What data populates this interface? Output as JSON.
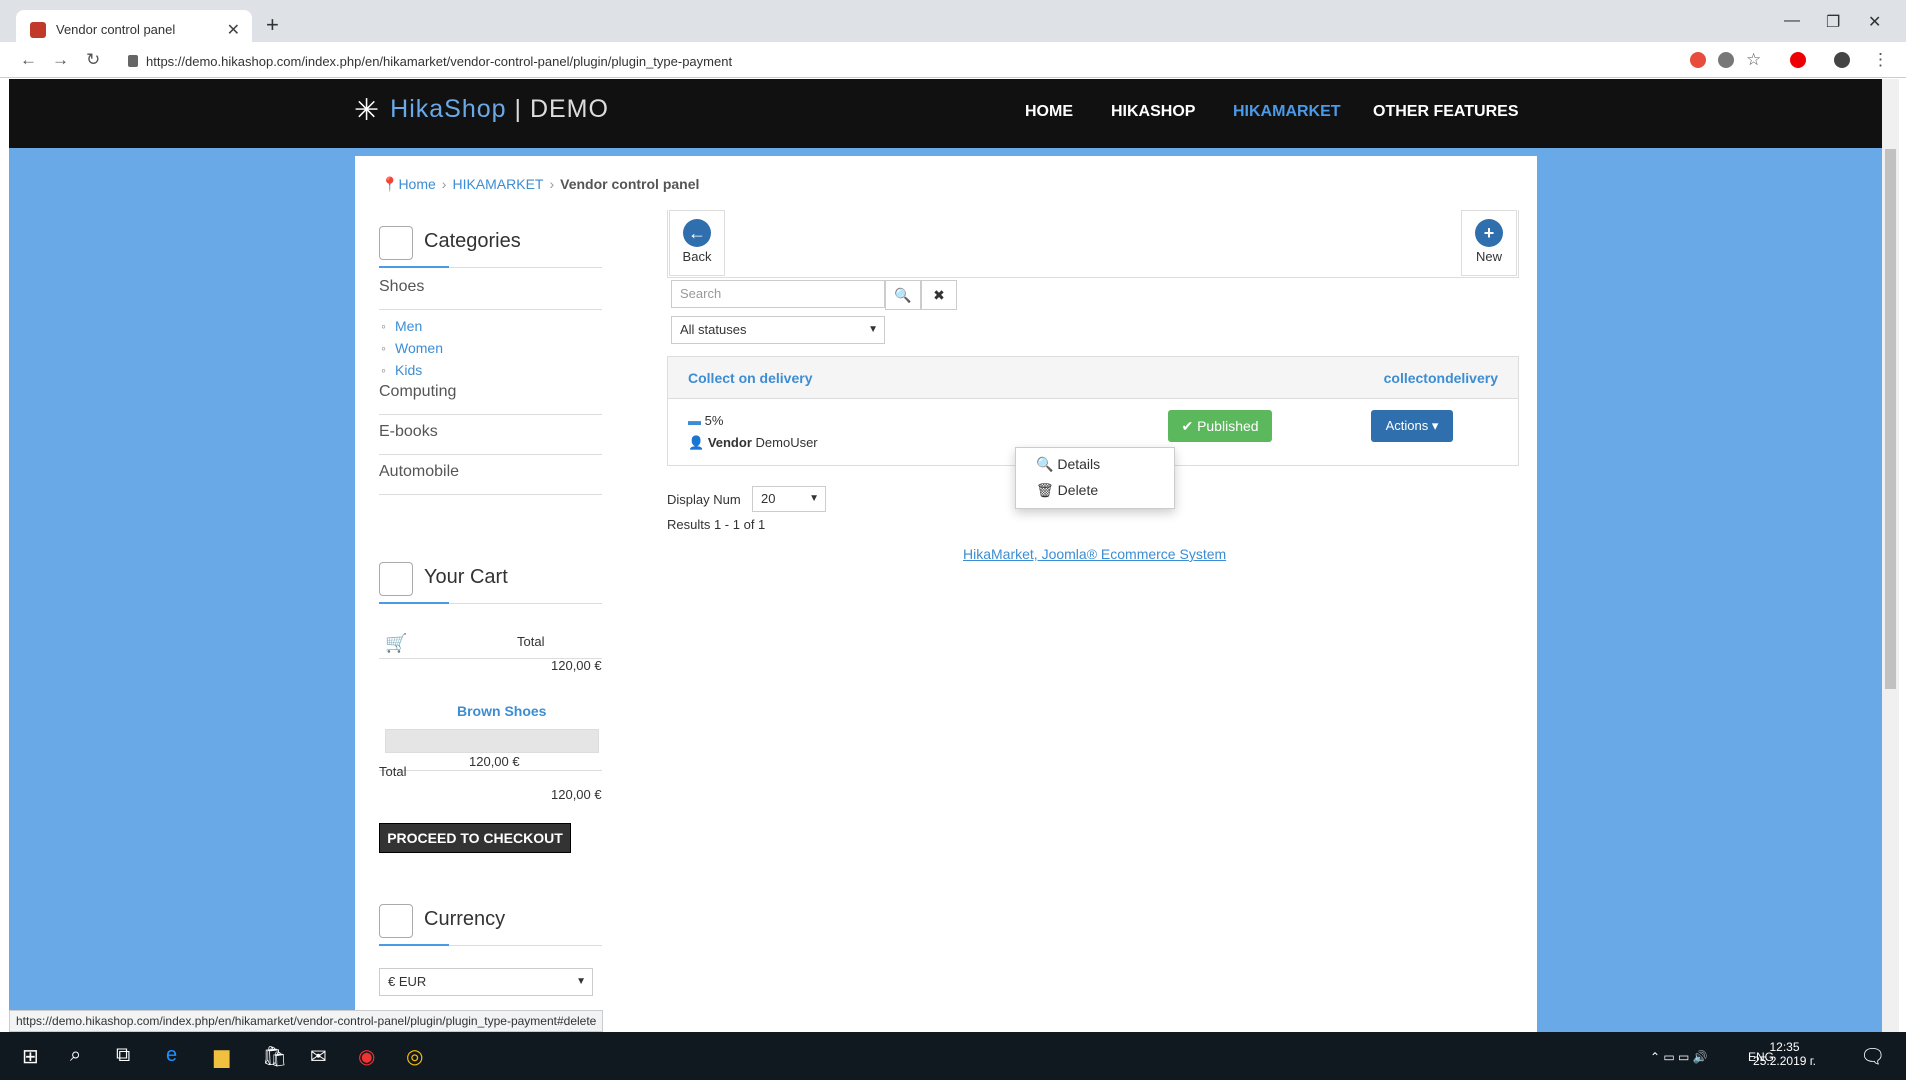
{
  "browser": {
    "tab_title": "Vendor control panel",
    "url": "https://demo.hikashop.com/index.php/en/hikamarket/vendor-control-panel/plugin/plugin_type-payment",
    "status_url": "https://demo.hikashop.com/index.php/en/hikamarket/vendor-control-panel/plugin/plugin_type-payment#delete"
  },
  "site": {
    "logo_left": "HikaShop",
    "logo_right": "| DEMO",
    "nav": [
      "HOME",
      "HIKASHOP",
      "HIKAMARKET",
      "OTHER FEATURES"
    ]
  },
  "breadcrumb": {
    "home": "Home",
    "middle": "HIKAMARKET",
    "current": "Vendor control panel"
  },
  "sidebar": {
    "categories_title": "Categories",
    "categories": [
      "Shoes",
      "Computing",
      "E-books",
      "Automobile"
    ],
    "subcategories": [
      "Men",
      "Women",
      "Kids"
    ],
    "cart_title": "Your Cart",
    "cart_total_label": "Total",
    "cart_total_value": "120,00 €",
    "product_name": "Brown Shoes",
    "product_price": "120,00 €",
    "total_label": "Total",
    "total_value": "120,00 €",
    "checkout": "PROCEED TO CHECKOUT",
    "currency_title": "Currency",
    "currency_value": "€ EUR"
  },
  "panel": {
    "back_label": "Back",
    "new_label": "New",
    "search_placeholder": "Search",
    "status_filter": "All statuses",
    "plugin_name": "Collect on delivery",
    "plugin_code": "collectondelivery",
    "fee": "5%",
    "vendor_label": "Vendor",
    "vendor_name": "DemoUser",
    "published": "Published",
    "actions": "Actions",
    "menu_details": "Details",
    "menu_delete": "Delete",
    "display_num_label": "Display Num",
    "display_num_value": "20",
    "results": "Results 1 - 1 of 1",
    "footer_link": "HikaMarket, Joomla® Ecommerce System"
  },
  "taskbar": {
    "lang": "ENG",
    "time": "12:35",
    "date": "25.2.2019 г."
  }
}
